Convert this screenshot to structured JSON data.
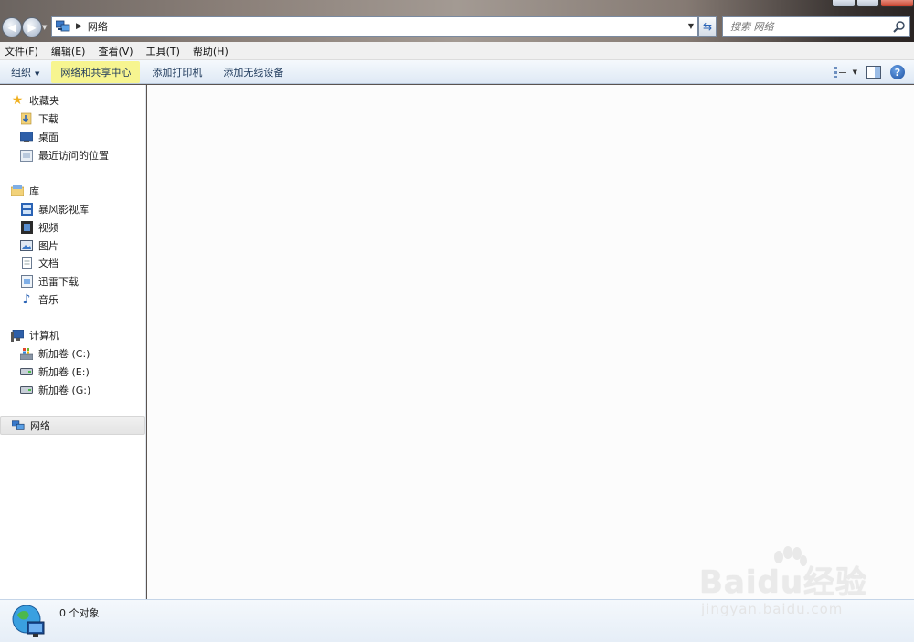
{
  "window": {
    "title_crumb": "网络"
  },
  "address_bar": {
    "location": "网络"
  },
  "search": {
    "placeholder": "搜索 网络"
  },
  "menu": {
    "items": [
      "文件(F)",
      "编辑(E)",
      "查看(V)",
      "工具(T)",
      "帮助(H)"
    ]
  },
  "toolbar": {
    "organize": "组织",
    "network_center": "网络和共享中心",
    "add_printer": "添加打印机",
    "add_wireless": "添加无线设备"
  },
  "sidebar": {
    "favorites": {
      "label": "收藏夹",
      "items": [
        "下载",
        "桌面",
        "最近访问的位置"
      ]
    },
    "libraries": {
      "label": "库",
      "items": [
        "暴风影视库",
        "视频",
        "图片",
        "文档",
        "迅雷下载",
        "音乐"
      ]
    },
    "computer": {
      "label": "计算机",
      "items": [
        "新加卷 (C:)",
        "新加卷 (E:)",
        "新加卷 (G:)"
      ]
    },
    "network": {
      "label": "网络"
    }
  },
  "status": {
    "object_count": "0 个对象"
  },
  "watermark": {
    "logo": "Baidu经验",
    "url": "jingyan.baidu.com"
  },
  "colors": {
    "highlight": "#f7f590",
    "accent": "#1e395b",
    "close_button": "#c8412c"
  }
}
